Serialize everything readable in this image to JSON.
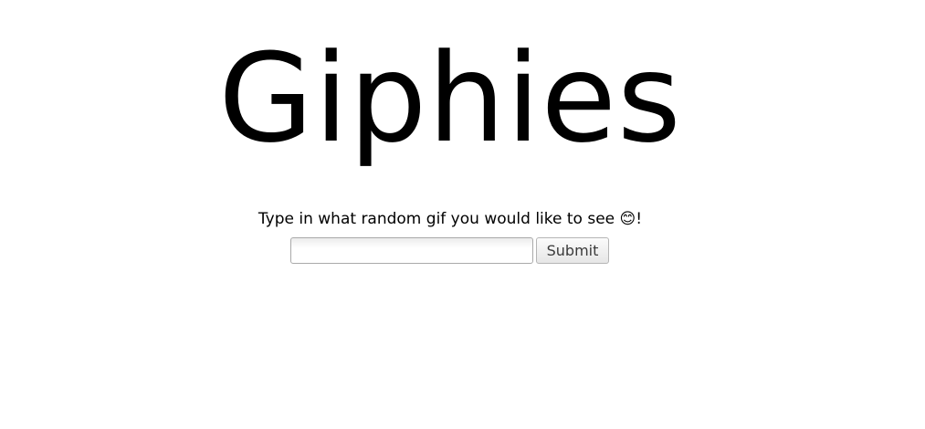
{
  "header": {
    "title": "Giphies"
  },
  "form": {
    "prompt": "Type in what random gif you would like to see 😊!",
    "search_value": "",
    "search_placeholder": "",
    "submit_label": "Submit"
  }
}
